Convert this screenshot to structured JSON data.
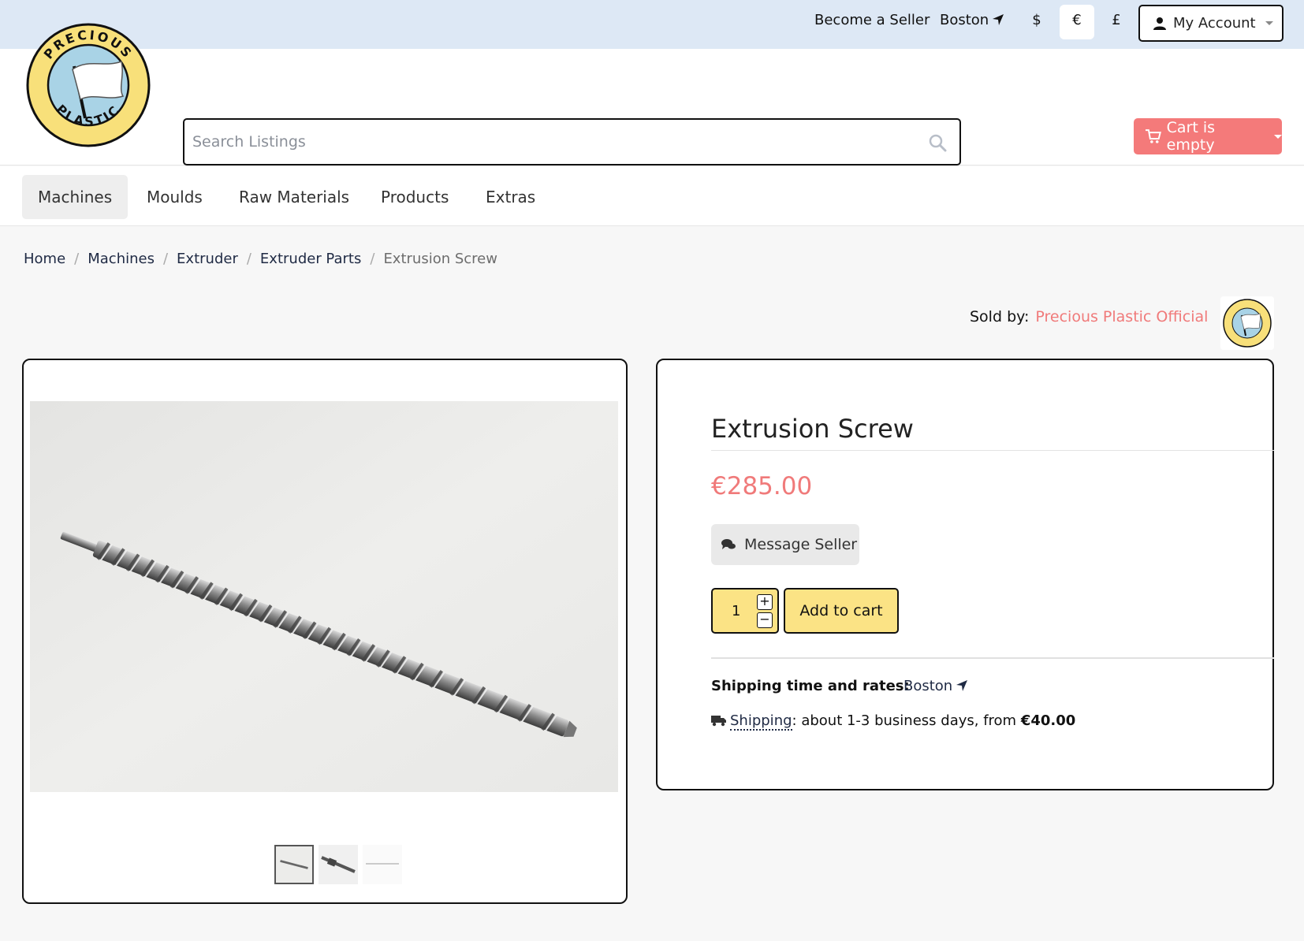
{
  "topbar": {
    "become_seller": "Become a Seller",
    "location": "Boston",
    "currencies": [
      "$",
      "€",
      "£"
    ],
    "selected_currency": "€",
    "account_label": "My Account"
  },
  "header": {
    "logo_text": "PRECIOUS PLASTIC",
    "search_placeholder": "Search Listings",
    "cart_label": "Cart is empty"
  },
  "nav": {
    "items": [
      "Machines",
      "Moulds",
      "Raw Materials",
      "Products",
      "Extras"
    ],
    "active": "Machines"
  },
  "breadcrumb": [
    "Home",
    "Machines",
    "Extruder",
    "Extruder Parts",
    "Extrusion Screw"
  ],
  "seller": {
    "label": "Sold by:",
    "name": "Precious Plastic Official"
  },
  "product": {
    "title": "Extrusion Screw",
    "price": "€285.00",
    "message_seller": "Message Seller",
    "quantity": "1",
    "add_to_cart": "Add to cart",
    "thumbnail_count": 3
  },
  "shipping": {
    "title": "Shipping time and rates:",
    "location": "Boston",
    "link_label": "Shipping",
    "detail": ": about 1-3 business days, from ",
    "price": "€40.00"
  },
  "colors": {
    "accent": "#f07a7a",
    "cart_button": "#f47a7a",
    "cta_yellow": "#fbe385",
    "topbar": "#dde8f5",
    "logo_yellow": "#f8e07a",
    "logo_blue": "#a9d3e6"
  }
}
